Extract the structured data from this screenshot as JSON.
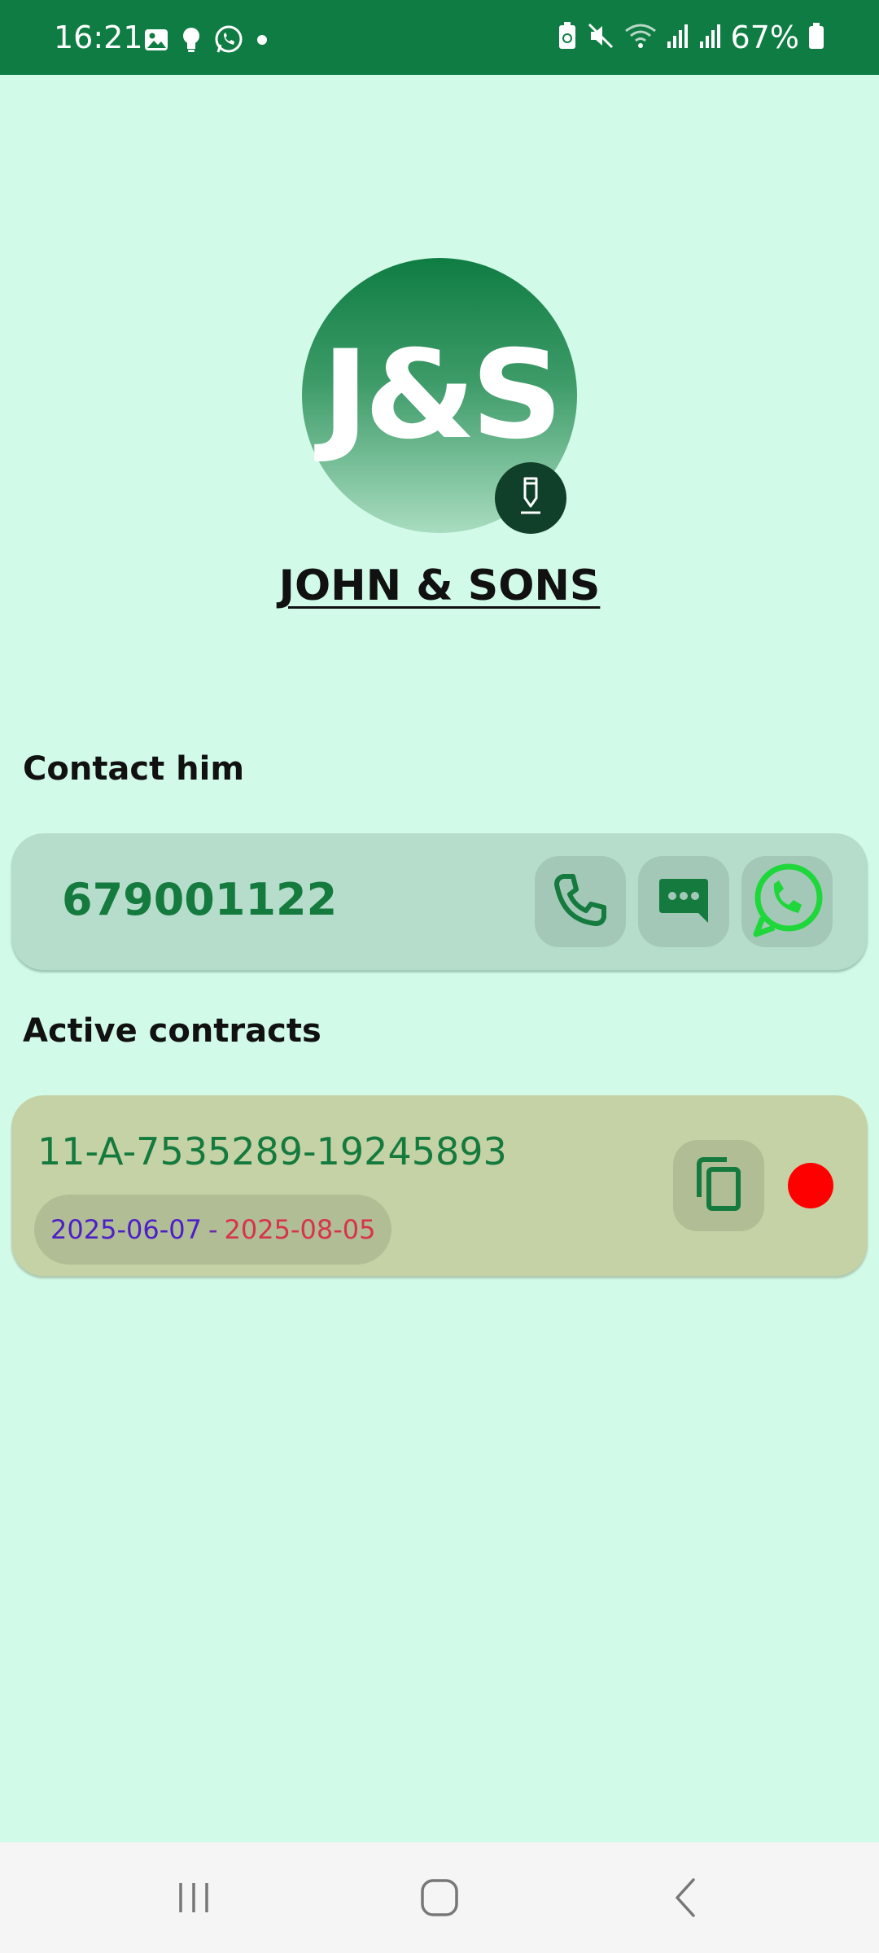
{
  "status_bar": {
    "time": "16:21",
    "battery": "67%",
    "left_icons": [
      "gallery-icon",
      "bulb-icon",
      "whatsapp-icon",
      "dot-icon"
    ],
    "right_icons": [
      "battery-saver-icon",
      "mute-icon",
      "wifi-icon",
      "signal-icon",
      "signal-icon",
      "battery-icon"
    ]
  },
  "profile": {
    "initials": "J&S",
    "name": "JOHN & SONS"
  },
  "contact": {
    "heading": "Contact him",
    "phone": "679001122",
    "actions": [
      "phone-icon",
      "message-icon",
      "whatsapp-icon"
    ]
  },
  "contracts": {
    "heading": "Active contracts",
    "items": [
      {
        "id": "11-A-7535289-19245893",
        "start": "2025-06-07",
        "separator": "-",
        "end": "2025-08-05",
        "status_color": "#ff0000"
      }
    ]
  },
  "colors": {
    "primary": "#0f7d43",
    "background": "#d1fae8",
    "whatsapp": "#1ed73a"
  },
  "nav": [
    "recent-apps-icon",
    "home-icon",
    "back-icon"
  ]
}
